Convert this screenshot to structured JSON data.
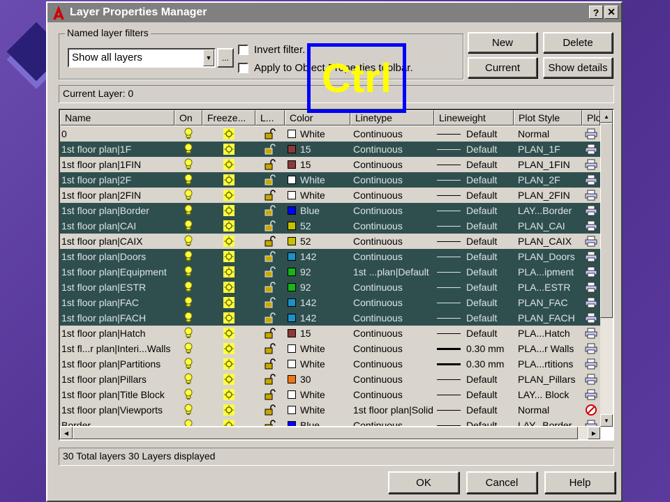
{
  "dialog": {
    "title": "Layer Properties Manager",
    "help_label": "?",
    "close_label": "✕"
  },
  "filters": {
    "group_label": "Named layer filters",
    "selected": "Show all layers",
    "ellipsis_label": "...",
    "invert_label": "Invert filter.",
    "apply_label": "Apply to Object Properties toolbar."
  },
  "buttons": {
    "new": "New",
    "delete": "Delete",
    "current": "Current",
    "show_details": "Show details",
    "ok": "OK",
    "cancel": "Cancel",
    "help": "Help"
  },
  "current_layer": "Current Layer:  0",
  "columns": [
    "Name",
    "On",
    "Freeze...",
    "L...",
    "Color",
    "Linetype",
    "Lineweight",
    "Plot Style",
    "Plo"
  ],
  "rows": [
    {
      "name": "0",
      "color": "White",
      "swatch": "#ffffff",
      "linetype": "Continuous",
      "lineweight": "Default",
      "thick": false,
      "plot_style": "Normal",
      "selected": false
    },
    {
      "name": "1st floor plan|1F",
      "color": "15",
      "swatch": "#8b3a3a",
      "linetype": "Continuous",
      "lineweight": "Default",
      "thick": false,
      "plot_style": "PLAN_1F",
      "selected": true
    },
    {
      "name": "1st floor plan|1FIN",
      "color": "15",
      "swatch": "#8b3a3a",
      "linetype": "Continuous",
      "lineweight": "Default",
      "thick": false,
      "plot_style": "PLAN_1FIN",
      "selected": false
    },
    {
      "name": "1st floor plan|2F",
      "color": "White",
      "swatch": "#ffffff",
      "linetype": "Continuous",
      "lineweight": "Default",
      "thick": false,
      "plot_style": "PLAN_2F",
      "selected": true
    },
    {
      "name": "1st floor plan|2FIN",
      "color": "White",
      "swatch": "#ffffff",
      "linetype": "Continuous",
      "lineweight": "Default",
      "thick": false,
      "plot_style": "PLAN_2FIN",
      "selected": false
    },
    {
      "name": "1st floor plan|Border",
      "color": "Blue",
      "swatch": "#0000ff",
      "linetype": "Continuous",
      "lineweight": "Default",
      "thick": false,
      "plot_style": "LAY...Border",
      "selected": true
    },
    {
      "name": "1st floor plan|CAI",
      "color": "52",
      "swatch": "#c8c000",
      "linetype": "Continuous",
      "lineweight": "Default",
      "thick": false,
      "plot_style": "PLAN_CAI",
      "selected": true
    },
    {
      "name": "1st floor plan|CAIX",
      "color": "52",
      "swatch": "#c8c000",
      "linetype": "Continuous",
      "lineweight": "Default",
      "thick": false,
      "plot_style": "PLAN_CAIX",
      "selected": false
    },
    {
      "name": "1st floor plan|Doors",
      "color": "142",
      "swatch": "#1e90c8",
      "linetype": "Continuous",
      "lineweight": "Default",
      "thick": false,
      "plot_style": "PLAN_Doors",
      "selected": true
    },
    {
      "name": "1st floor plan|Equipment",
      "color": "92",
      "swatch": "#18b418",
      "linetype": "1st ...plan|Default",
      "lineweight": "Default",
      "thick": false,
      "plot_style": "PLA...ipment",
      "selected": true
    },
    {
      "name": "1st floor plan|ESTR",
      "color": "92",
      "swatch": "#18b418",
      "linetype": "Continuous",
      "lineweight": "Default",
      "thick": false,
      "plot_style": "PLA...ESTR",
      "selected": true
    },
    {
      "name": "1st floor plan|FAC",
      "color": "142",
      "swatch": "#1e90c8",
      "linetype": "Continuous",
      "lineweight": "Default",
      "thick": false,
      "plot_style": "PLAN_FAC",
      "selected": true
    },
    {
      "name": "1st floor plan|FACH",
      "color": "142",
      "swatch": "#1e90c8",
      "linetype": "Continuous",
      "lineweight": "Default",
      "thick": false,
      "plot_style": "PLAN_FACH",
      "selected": true
    },
    {
      "name": "1st floor plan|Hatch",
      "color": "15",
      "swatch": "#8b3a3a",
      "linetype": "Continuous",
      "lineweight": "Default",
      "thick": false,
      "plot_style": "PLA...Hatch",
      "selected": false
    },
    {
      "name": "1st fl...r plan|Interi...Walls",
      "color": "White",
      "swatch": "#ffffff",
      "linetype": "Continuous",
      "lineweight": "0.30 mm",
      "thick": true,
      "plot_style": "PLA...r Walls",
      "selected": false
    },
    {
      "name": "1st floor plan|Partitions",
      "color": "White",
      "swatch": "#ffffff",
      "linetype": "Continuous",
      "lineweight": "0.30 mm",
      "thick": true,
      "plot_style": "PLA...rtitions",
      "selected": false
    },
    {
      "name": "1st floor plan|Pillars",
      "color": "30",
      "swatch": "#f07814",
      "linetype": "Continuous",
      "lineweight": "Default",
      "thick": false,
      "plot_style": "PLAN_Pillars",
      "selected": false
    },
    {
      "name": "1st floor plan|Title Block",
      "color": "White",
      "swatch": "#ffffff",
      "linetype": "Continuous",
      "lineweight": "Default",
      "thick": false,
      "plot_style": "LAY... Block",
      "selected": false
    },
    {
      "name": "1st floor plan|Viewports",
      "color": "White",
      "swatch": "#ffffff",
      "linetype": "1st floor plan|Solid",
      "lineweight": "Default",
      "thick": false,
      "plot_style": "Normal",
      "selected": false,
      "no_plot": true
    },
    {
      "name": "Border",
      "color": "Blue",
      "swatch": "#0000ff",
      "linetype": "Continuous",
      "lineweight": "Default",
      "thick": false,
      "plot_style": "LAY...Border",
      "selected": false
    }
  ],
  "status": "30 Total layers    30 Layers displayed",
  "overlay": {
    "label": "Ctrl"
  },
  "colors": {
    "selection": "#2f4f4f",
    "overlay_border": "#0000ff",
    "overlay_text": "#ffff00"
  }
}
